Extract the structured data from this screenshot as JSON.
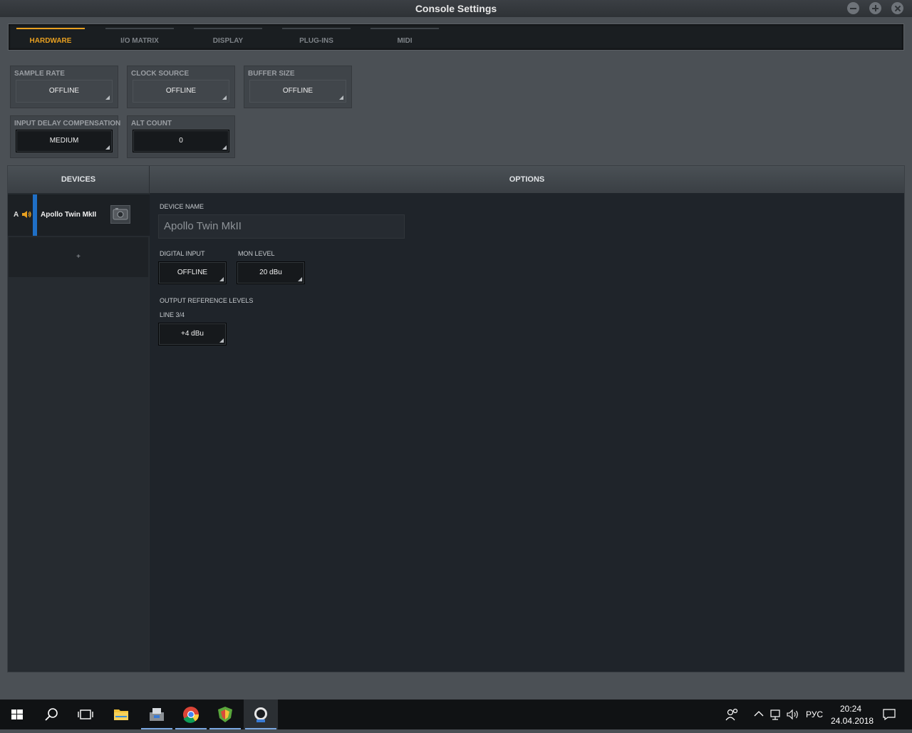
{
  "window": {
    "title": "Console Settings"
  },
  "tabs": [
    {
      "label": "HARDWARE",
      "active": true
    },
    {
      "label": "I/O MATRIX",
      "active": false
    },
    {
      "label": "DISPLAY",
      "active": false
    },
    {
      "label": "PLUG-INS",
      "active": false
    },
    {
      "label": "MIDI",
      "active": false
    }
  ],
  "hardware": {
    "sample_rate": {
      "label": "SAMPLE RATE",
      "value": "OFFLINE"
    },
    "clock_source": {
      "label": "CLOCK SOURCE",
      "value": "OFFLINE"
    },
    "buffer_size": {
      "label": "BUFFER SIZE",
      "value": "OFFLINE"
    },
    "input_delay_compensation": {
      "label": "INPUT DELAY COMPENSATION",
      "value": "MEDIUM"
    },
    "alt_count": {
      "label": "ALT COUNT",
      "value": "0"
    }
  },
  "devices": {
    "header": "DEVICES",
    "items": [
      {
        "letter": "A",
        "name": "Apollo Twin MkII"
      }
    ],
    "add_label": "+"
  },
  "options": {
    "header": "OPTIONS",
    "device_name_label": "DEVICE NAME",
    "device_name_value": "Apollo Twin MkII",
    "digital_input": {
      "label": "DIGITAL INPUT",
      "value": "OFFLINE"
    },
    "mon_level": {
      "label": "MON LEVEL",
      "value": "20 dBu"
    },
    "output_reference_levels_label": "OUTPUT REFERENCE LEVELS",
    "line_34": {
      "label": "LINE 3/4",
      "value": "+4 dBu"
    }
  },
  "taskbar": {
    "language": "РУС",
    "time": "20:24",
    "date": "24.04.2018"
  },
  "colors": {
    "accent": "#e8a020",
    "device_accent": "#1f6fc6"
  }
}
